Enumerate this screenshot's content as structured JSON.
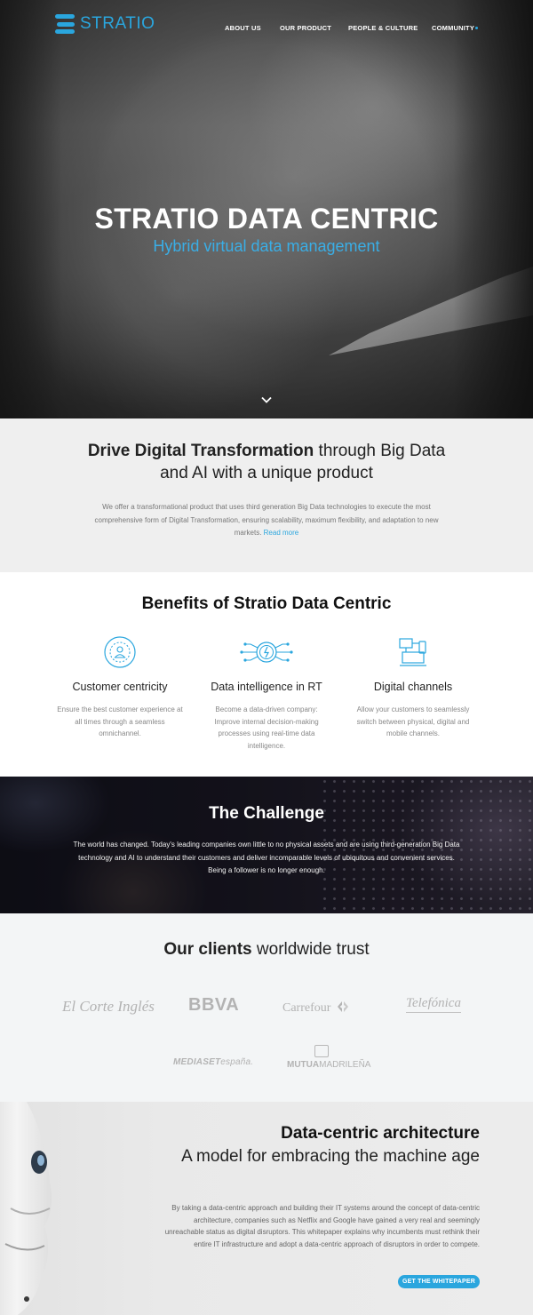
{
  "header": {
    "logo_text": "STRATIO",
    "nav": [
      "ABOUT US",
      "OUR PRODUCT",
      "PEOPLE & CULTURE",
      "COMMUNITY"
    ]
  },
  "hero": {
    "title": "STRATIO DATA CENTRIC",
    "subtitle": "Hybrid virtual data management"
  },
  "drive": {
    "title_bold": "Drive Digital Transformation",
    "title_rest_1": " through Big Data",
    "title_rest_2": "and AI with a unique product",
    "body": "We offer a transformational product that uses third generation Big Data technologies to execute the most comprehensive form of Digital Transformation, ensuring scalability, maximum flexibility, and adaptation to new markets.",
    "read_more": "Read more"
  },
  "benefits": {
    "title": "Benefits of Stratio Data Centric",
    "items": [
      {
        "title": "Customer centricity",
        "body": "Ensure the best customer experience at all times through a seamless omnichannel.",
        "icon": "customer-icon"
      },
      {
        "title": "Data intelligence in RT",
        "body": "Become a data-driven company: Improve internal decision-making processes using real-time data intelligence.",
        "icon": "data-intelligence-icon"
      },
      {
        "title": "Digital channels",
        "body": "Allow your customers to seamlessly switch between physical, digital and mobile channels.",
        "icon": "digital-channels-icon"
      }
    ]
  },
  "challenge": {
    "title": "The Challenge",
    "body": "The world has changed. Today's leading companies own little to no physical assets and are using third-generation Big Data technology and AI to understand their customers and deliver incomparable levels of ubiquitous and convenient services. Being a follower is no longer enough."
  },
  "clients": {
    "title_bold": "Our clients",
    "title_rest": " worldwide trust",
    "logos": {
      "el_corte_ingles": "El Corte Inglés",
      "bbva": "BBVA",
      "carrefour": "Carrefour",
      "telefonica": "Telefónica",
      "mediaset_a": "MEDIASET",
      "mediaset_b": "españa.",
      "mutua_a": "MUTUA",
      "mutua_b": "MADRILEÑA"
    }
  },
  "architecture": {
    "title": "Data-centric architecture",
    "subtitle": "A model for embracing the machine age",
    "body": "By taking a data-centric approach and building their IT systems around the concept of data-centric architecture, companies such as Netflix and Google have gained a very real and seemingly unreachable status as digital disruptors. This whitepaper explains why incumbents must rethink their entire IT infrastructure and adopt a data-centric approach of disruptors in order to compete.",
    "cta": "GET THE WHITEPAPER"
  },
  "colors": {
    "accent": "#2aa6de",
    "light_bg": "#efefef",
    "clients_bg": "#f3f5f6"
  }
}
